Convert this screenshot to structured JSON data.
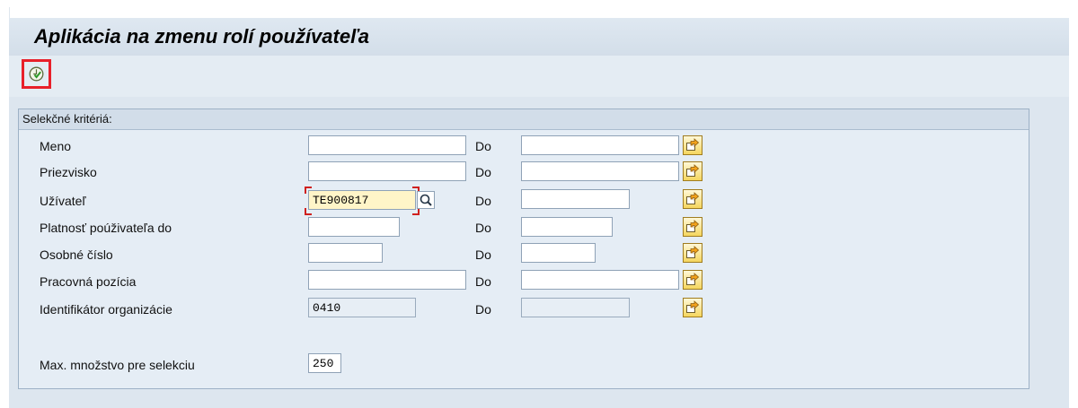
{
  "window": {
    "title": "Aplikácia na zmenu rolí používateľa"
  },
  "toolbar": {
    "execute_icon": "execute-clock-check-icon"
  },
  "selection": {
    "group_title": "Selekčné kritériá:",
    "range_label": "Do",
    "rows": [
      {
        "label": "Meno",
        "from": "",
        "to": ""
      },
      {
        "label": "Priezvisko",
        "from": "",
        "to": ""
      },
      {
        "label": "Užívateľ",
        "from": "TE900817",
        "to": ""
      },
      {
        "label": "Platnosť poúživateľa do",
        "from": "",
        "to": ""
      },
      {
        "label": "Osobné číslo",
        "from": "",
        "to": ""
      },
      {
        "label": "Pracovná pozícia",
        "from": "",
        "to": ""
      },
      {
        "label": "Identifikátor organizácie",
        "from": "0410",
        "to": ""
      }
    ],
    "max_label": "Max. množstvo pre selekciu",
    "max_value": "250"
  },
  "colors": {
    "highlight_border": "#e8202a",
    "focused_field": "#fff5c8"
  }
}
